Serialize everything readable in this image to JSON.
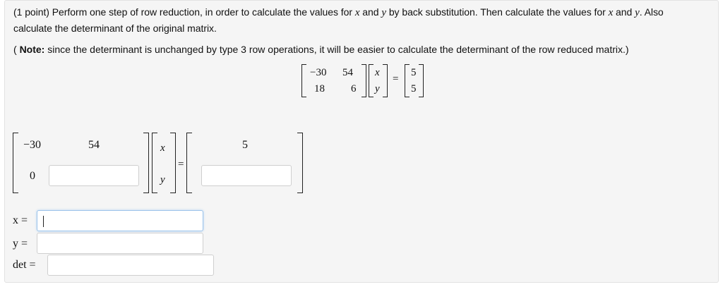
{
  "problem": {
    "points": "(1 point)",
    "text_a": "Perform one step of row reduction, in order to calculate the values for",
    "var_x": "x",
    "and": "and",
    "var_y": "y",
    "text_b": "by back substitution. Then calculate the values for",
    "text_c": ". Also",
    "line2": "calculate the determinant of the original matrix."
  },
  "note": {
    "open": "(",
    "bold": "Note:",
    "text": "since the determinant is unchanged by type 3 row operations, it will be easier to calculate the determinant of the row reduced matrix.)"
  },
  "system": {
    "a11": "−30",
    "a12": "54",
    "a21": "18",
    "a22": "6",
    "x": "x",
    "y": "y",
    "eq": "=",
    "b1": "5",
    "b2": "5"
  },
  "reduced": {
    "r11": "−30",
    "r12": "54",
    "r21": "0",
    "x": "x",
    "y": "y",
    "eq": "=",
    "b1": "5",
    "r22_value": "",
    "b2_value": ""
  },
  "answers": {
    "x_label": "x =",
    "y_label": "y =",
    "det_label": "det =",
    "x_value": "",
    "y_value": "",
    "det_value": ""
  }
}
